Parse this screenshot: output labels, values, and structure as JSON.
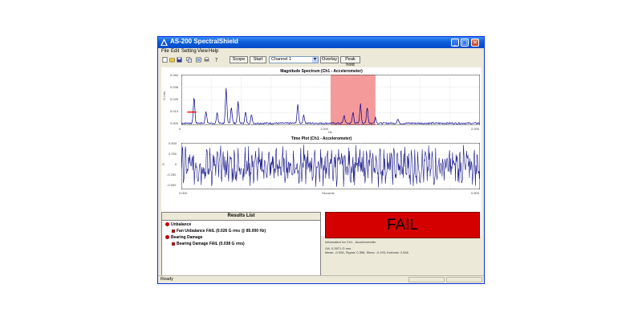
{
  "window": {
    "title": "AS-200 SpectralShield"
  },
  "menu": [
    "File",
    "Edit",
    "Setting",
    "View",
    "Help"
  ],
  "toolbar": {
    "icons": [
      "new-icon",
      "open-icon",
      "save-icon",
      "copy-icon",
      "export-icon",
      "print-icon",
      "help-icon"
    ],
    "scope_label": "Scope",
    "start_label": "Start",
    "channel_value": "Channel 1",
    "overlay_label": "Overlay",
    "peakhold_label": "Peak hold"
  },
  "spectrum": {
    "title": "Magnitude Spectrum (Ch1 - Accelerometer)",
    "ylabel": "G rms",
    "xlabel": "Hz",
    "y_ticks": [
      "0.050",
      "0.038",
      "0.025",
      "0.013",
      "0.000"
    ],
    "x_ticks": [
      "0",
      "1,000",
      "2,000"
    ],
    "fail_band": [
      1000,
      1300
    ],
    "threshold": {
      "x": [
        40,
        100
      ],
      "y": 0.013
    }
  },
  "timeplot": {
    "title": "Time Plot (Ch1 - Accelerometer)",
    "ylabel": "G",
    "xlabel": "Seconds",
    "y_ticks": [
      "0.500",
      "0.250",
      "0",
      "-0.250",
      "-0.500"
    ],
    "x_ticks": [
      "0.000",
      "0.800"
    ]
  },
  "results": {
    "title": "Results List",
    "groups": [
      {
        "name": "Unbalance",
        "items": [
          "Fan Unbalance FAIL (0.026 G rms @ 85.000 Hz)"
        ]
      },
      {
        "name": "Bearing Damage",
        "items": [
          "Bearing Damage FAIL (0.038 G rms)"
        ]
      }
    ]
  },
  "verdict": "FAIL",
  "info": {
    "heading": "Information for Ch1 - Accelerometer",
    "line1": "OA: 0.3571 G rms",
    "line2": "Mean: -0.006, Sigma: 0.356, Skew: -0.193, Kurtosis: 2.546"
  },
  "status": "Ready",
  "colors": {
    "trace": "#00008b",
    "fail": "#d40000",
    "band": "#f49a9a",
    "threshold": "#ff0000"
  }
}
